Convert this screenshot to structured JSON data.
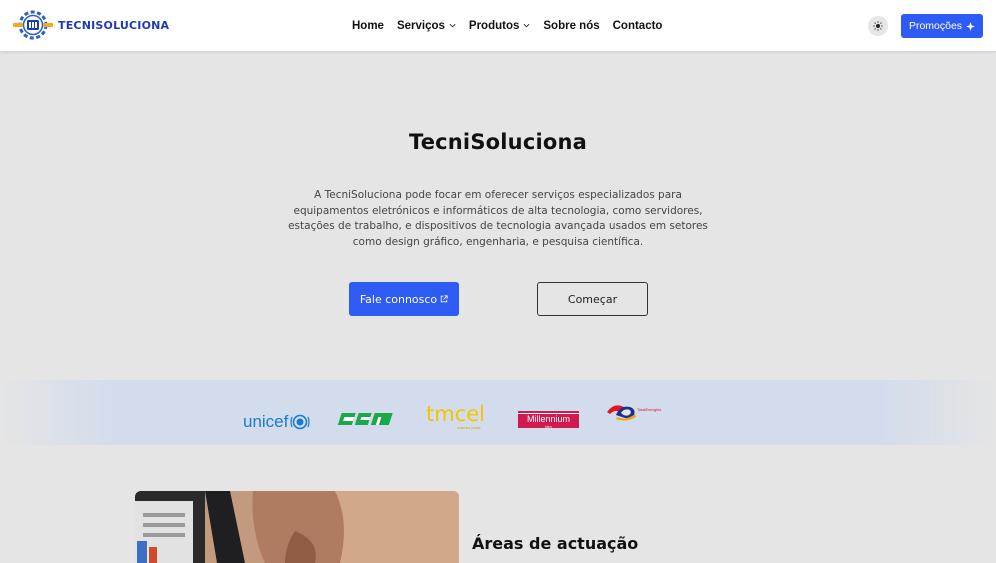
{
  "brand": {
    "name": "TECNISOLUCIONA"
  },
  "nav": {
    "items": [
      {
        "label": "Home",
        "dropdown": false
      },
      {
        "label": "Serviços",
        "dropdown": true
      },
      {
        "label": "Produtos",
        "dropdown": true
      },
      {
        "label": "Sobre nós",
        "dropdown": false
      },
      {
        "label": "Contacto",
        "dropdown": false
      }
    ]
  },
  "header": {
    "theme_icon": "sun-icon",
    "promo_label": "Promoções",
    "promo_icon": "sparkle-icon"
  },
  "hero": {
    "title": "TecniSoluciona",
    "description": "A TecniSoluciona pode focar em oferecer serviços especializados para equipamentos eletrónicos e informáticos de alta tecnologia, como servidores, estações de trabalho, e dispositivos de tecnologia avançada usados em setores como design gráfico, engenharia, e pesquisa científica.",
    "primary_button": "Fale connosco",
    "primary_icon": "external-link-icon",
    "secondary_button": "Começar"
  },
  "partners": {
    "unicef": "unicef",
    "cfm": "CFM",
    "tmcel": "tmcel",
    "tmcel_tagline": "estamos juntos",
    "millennium": "Millennium",
    "millennium_sub": "bim",
    "total": "TotalEnergies"
  },
  "section": {
    "title": "Áreas de actuação"
  },
  "colors": {
    "accent": "#2f5bf5",
    "brand_blue": "#1f3bb3",
    "band": "#d2dcec",
    "background": "#e5e5e5"
  }
}
